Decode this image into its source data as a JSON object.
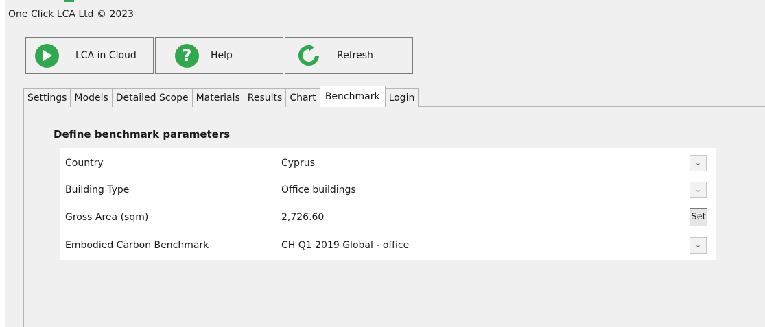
{
  "window": {
    "title": "One Click LCA Ltd © 2023"
  },
  "toolbar": {
    "cloud": {
      "label": "LCA in Cloud",
      "icon": "arrow-right-icon"
    },
    "help": {
      "label": "Help",
      "icon": "question-icon"
    },
    "refresh": {
      "label": "Refresh",
      "icon": "refresh-icon"
    },
    "accent_color": "#2fa84f"
  },
  "tabs": [
    {
      "label": "Settings"
    },
    {
      "label": "Models"
    },
    {
      "label": "Detailed Scope"
    },
    {
      "label": "Materials"
    },
    {
      "label": "Results"
    },
    {
      "label": "Chart"
    },
    {
      "label": "Benchmark",
      "active": true
    },
    {
      "label": "Login"
    }
  ],
  "benchmark": {
    "section_title": "Define benchmark parameters",
    "rows": [
      {
        "label": "Country",
        "value": "Cyprus",
        "control": "dropdown"
      },
      {
        "label": "Building Type",
        "value": "Office buildings",
        "control": "dropdown"
      },
      {
        "label": "Gross Area (sqm)",
        "value": "2,726.60",
        "control": "button",
        "button_label": "Set"
      },
      {
        "label": "Embodied Carbon Benchmark",
        "value": "CH Q1 2019 Global - office",
        "control": "dropdown"
      }
    ]
  }
}
